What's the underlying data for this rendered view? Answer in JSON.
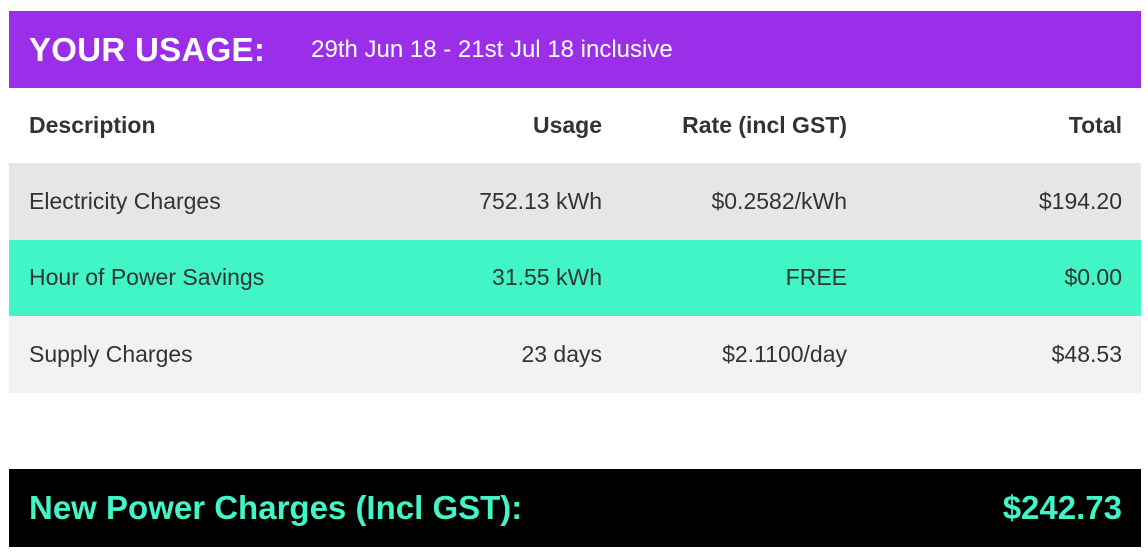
{
  "header": {
    "title": "YOUR USAGE:",
    "period": "29th Jun 18 - 21st Jul 18 inclusive"
  },
  "table": {
    "columns": {
      "description": "Description",
      "usage": "Usage",
      "rate": "Rate (incl GST)",
      "total": "Total"
    },
    "rows": [
      {
        "description": "Electricity Charges",
        "usage": "752.13 kWh",
        "rate": "$0.2582/kWh",
        "total": "$194.20"
      },
      {
        "description": "Hour of Power Savings",
        "usage": "31.55 kWh",
        "rate": "FREE",
        "total": "$0.00"
      },
      {
        "description": "Supply Charges",
        "usage": "23 days",
        "rate": "$2.1100/day",
        "total": "$48.53"
      }
    ]
  },
  "footer": {
    "label": "New Power Charges (Incl GST):",
    "amount": "$242.73"
  },
  "colors": {
    "header_bg": "#9b2ee8",
    "highlight_row": "#41f5c6",
    "footer_bg": "#000000",
    "footer_text": "#41f5c6"
  }
}
